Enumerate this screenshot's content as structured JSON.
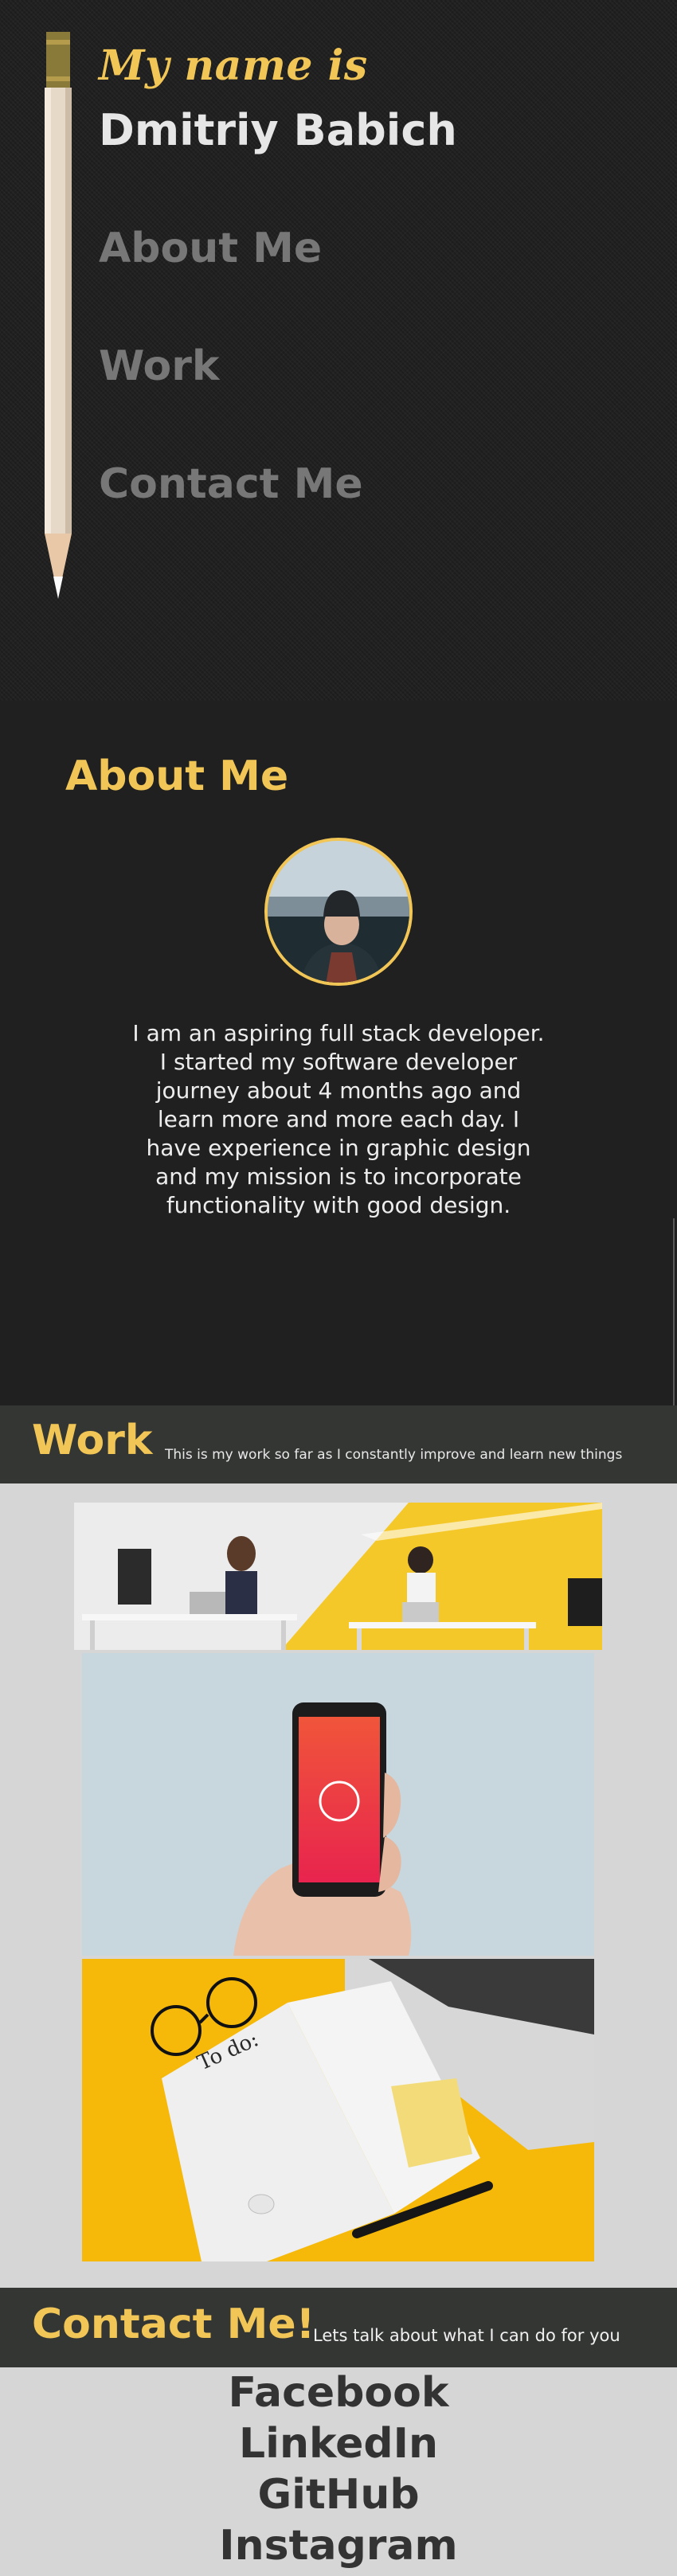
{
  "hero": {
    "intro": "My name is",
    "name": "Dmitriy Babich"
  },
  "nav": {
    "about": "About Me",
    "work": "Work",
    "contact": "Contact Me"
  },
  "about": {
    "title": "About Me",
    "text": "I am an aspiring full stack developer. I started my software developer journey about 4 months ago and learn more and more each day. I have experience in graphic design and my mission is to incorporate functionality with good design."
  },
  "work": {
    "title": "Work",
    "subtitle": "This is my work so far as I constantly improve and learn new things",
    "projects": [
      {
        "image": "office-desks-image"
      },
      {
        "image": "phone-in-hand-image"
      },
      {
        "image": "todo-notebook-image"
      }
    ]
  },
  "contact": {
    "title": "Contact Me!",
    "subtitle": "Lets talk about what I can do for you",
    "links": [
      "Facebook",
      "LinkedIn",
      "GitHub",
      "Instagram"
    ]
  },
  "colors": {
    "accent": "#f1c656",
    "dark_bg": "#202020",
    "bar_bg": "#343634",
    "light_bg": "#d6d6d6",
    "nav_text": "#777777"
  }
}
